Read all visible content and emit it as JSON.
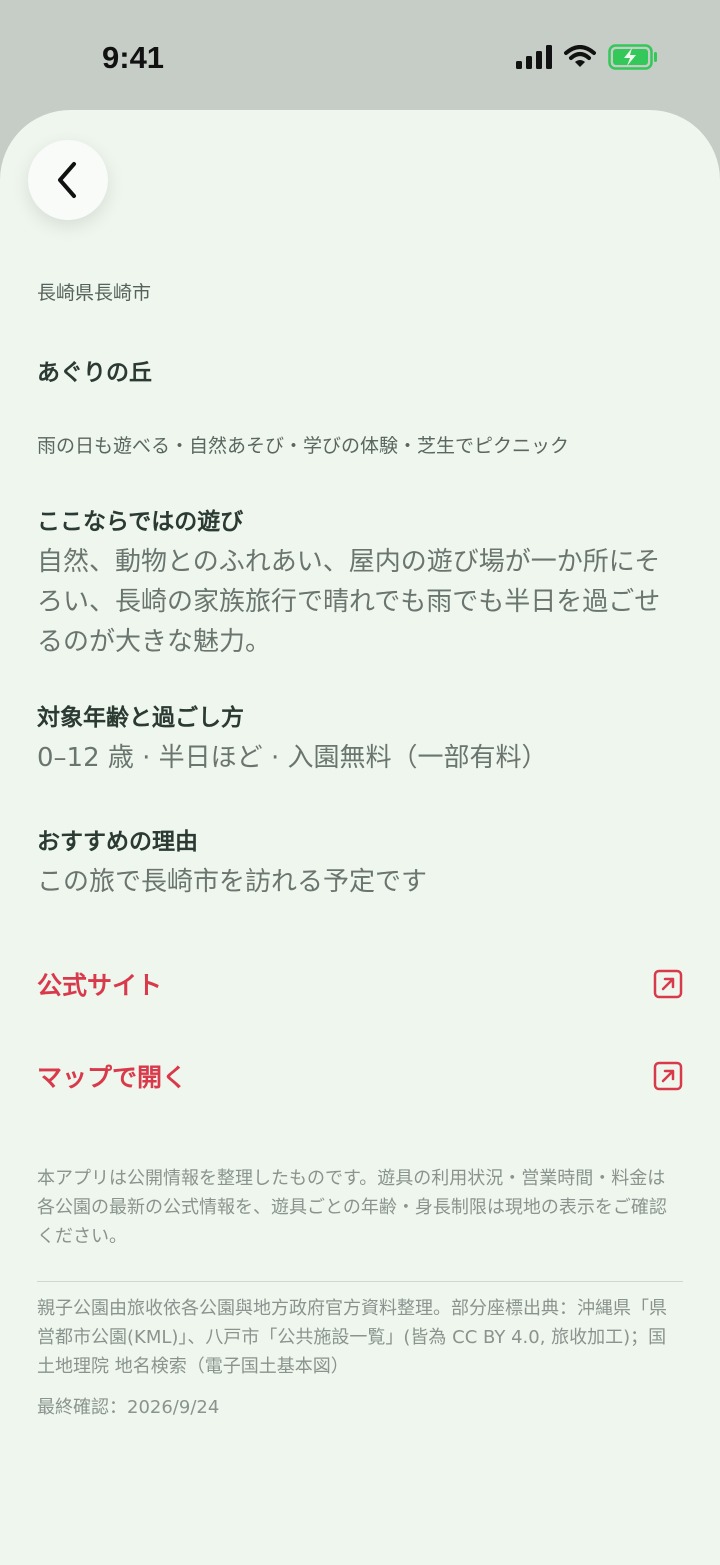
{
  "status": {
    "time": "9:41"
  },
  "place": {
    "location": "長崎県長崎市",
    "name": "あぐりの丘",
    "tags": "雨の日も遊べる・自然あそび・学びの体験・芝生でピクニック"
  },
  "sections": [
    {
      "title": "ここならではの遊び",
      "body": "自然、動物とのふれあい、屋内の遊び場が一か所にそろい、長崎の家族旅行で晴れでも雨でも半日を過ごせるのが大きな魅力。"
    },
    {
      "title": "対象年齢と過ごし方",
      "body": "0–12 歳 · 半日ほど · 入園無料（一部有料）"
    },
    {
      "title": "おすすめの理由",
      "body": "この旅で長崎市を訪れる予定です"
    }
  ],
  "links": {
    "official": "公式サイト",
    "map": "マップで開く"
  },
  "disclaimer": "本アプリは公開情報を整理したものです。遊具の利用状況・営業時間・料金は各公園の最新の公式情報を、遊具ごとの年齢・身長制限は現地の表示をご確認ください。",
  "credits": "親子公園由旅收依各公園與地方政府官方資料整理。部分座標出典：沖縄県「県営都市公園(KML)」、八戸市「公共施設一覧」(皆為 CC BY 4.0, 旅收加工)；国土地理院 地名検索（電子国土基本図）",
  "last_checked": "最終確認：2026/9/24",
  "colors": {
    "accent": "#d93a4b",
    "sheet_bg": "#eef6ee",
    "battery": "#34c759"
  }
}
